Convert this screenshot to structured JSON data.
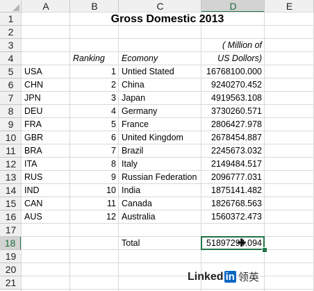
{
  "columns": [
    "A",
    "B",
    "C",
    "D",
    "E"
  ],
  "rows": [
    "1",
    "2",
    "3",
    "4",
    "5",
    "6",
    "7",
    "8",
    "9",
    "10",
    "11",
    "12",
    "13",
    "14",
    "15",
    "16",
    "17",
    "18",
    "19",
    "20",
    "21"
  ],
  "title": "Gross Domestic 2013",
  "units_line1": "( Million of",
  "units_line2": "US Dollors)",
  "headers": {
    "ranking": "Ranking",
    "economy": "Ecomony"
  },
  "data_rows": [
    {
      "code": "USA",
      "rank": "1",
      "economy": "Untied Stated",
      "gdp": "16768100.000"
    },
    {
      "code": "CHN",
      "rank": "2",
      "economy": "China",
      "gdp": "9240270.452"
    },
    {
      "code": "JPN",
      "rank": "3",
      "economy": "Japan",
      "gdp": "4919563.108"
    },
    {
      "code": "DEU",
      "rank": "4",
      "economy": "Germany",
      "gdp": "3730260.571"
    },
    {
      "code": "FRA",
      "rank": "5",
      "economy": "France",
      "gdp": "2806427.978"
    },
    {
      "code": "GBR",
      "rank": "6",
      "economy": "United Kingdom",
      "gdp": "2678454.887"
    },
    {
      "code": "BRA",
      "rank": "7",
      "economy": "Brazil",
      "gdp": "2245673.032"
    },
    {
      "code": "ITA",
      "rank": "8",
      "economy": "Italy",
      "gdp": "2149484.517"
    },
    {
      "code": "RUS",
      "rank": "9",
      "economy": "Russian Federation",
      "gdp": "2096777.031"
    },
    {
      "code": "IND",
      "rank": "10",
      "economy": "India",
      "gdp": "1875141.482"
    },
    {
      "code": "CAN",
      "rank": "11",
      "economy": "Canada",
      "gdp": "1826768.563"
    },
    {
      "code": "AUS",
      "rank": "12",
      "economy": "Australia",
      "gdp": "1560372.473"
    }
  ],
  "total_label": "Total",
  "total_value": "51897294.094",
  "selected_cell": "D18",
  "selection_color": "#217346",
  "watermark": {
    "linked": "Linked",
    "in": "in",
    "cn": "领英"
  }
}
